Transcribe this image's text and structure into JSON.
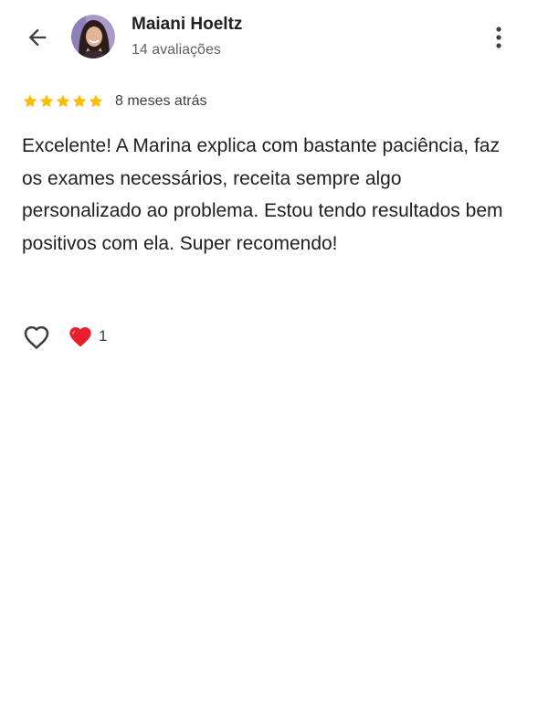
{
  "header": {
    "back_icon": "arrow-back-icon",
    "user_name": "Maiani Hoeltz",
    "review_count": "14 avaliações",
    "more_icon": "more-vert-icon"
  },
  "review": {
    "rating": 5,
    "rating_max": 5,
    "star_color": "#fbbc04",
    "time": "8 meses atrás",
    "text": "Excelente! A Marina explica com bastante paciência, faz os exames necessários, receita sempre algo personalizado ao problema. Estou tendo resultados bem positivos com ela. Super recomendo!"
  },
  "reactions": {
    "like_icon": "heart-outline-icon",
    "summary_icon": "red-heart-icon",
    "heart_color": "#e8202c",
    "count": "1"
  }
}
